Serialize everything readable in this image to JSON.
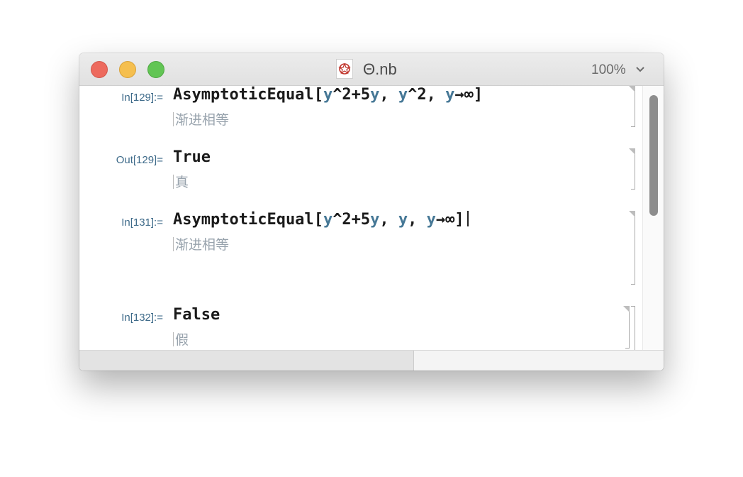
{
  "window": {
    "title": "Θ.nb",
    "zoom": "100%",
    "doc_icon": "mathematica-spikey-icon"
  },
  "cells": [
    {
      "label": "In[129]:=",
      "code": [
        {
          "t": "AsymptoticEqual",
          "c": "fn"
        },
        {
          "t": "[",
          "c": "p"
        },
        {
          "t": "y",
          "c": "var"
        },
        {
          "t": "^2+5",
          "c": "p"
        },
        {
          "t": "y",
          "c": "var"
        },
        {
          "t": ", ",
          "c": "p"
        },
        {
          "t": "y",
          "c": "var"
        },
        {
          "t": "^2, ",
          "c": "p"
        },
        {
          "t": "y",
          "c": "var"
        },
        {
          "t": "→∞]",
          "c": "p"
        }
      ],
      "hint": "渐进相等"
    },
    {
      "label": "Out[129]=",
      "code": [
        {
          "t": "True",
          "c": "fn"
        }
      ],
      "hint": "真"
    },
    {
      "label": "In[131]:=",
      "code": [
        {
          "t": "AsymptoticEqual",
          "c": "fn"
        },
        {
          "t": "[",
          "c": "p"
        },
        {
          "t": "y",
          "c": "var"
        },
        {
          "t": "^2+5",
          "c": "p"
        },
        {
          "t": "y",
          "c": "var"
        },
        {
          "t": ", ",
          "c": "p"
        },
        {
          "t": "y",
          "c": "var"
        },
        {
          "t": ", ",
          "c": "p"
        },
        {
          "t": "y",
          "c": "var"
        },
        {
          "t": "→∞]",
          "c": "p"
        }
      ],
      "hint": "渐进相等"
    },
    {
      "label": "In[132]:=",
      "code": [
        {
          "t": "False",
          "c": "fn"
        }
      ],
      "hint": "假"
    }
  ]
}
